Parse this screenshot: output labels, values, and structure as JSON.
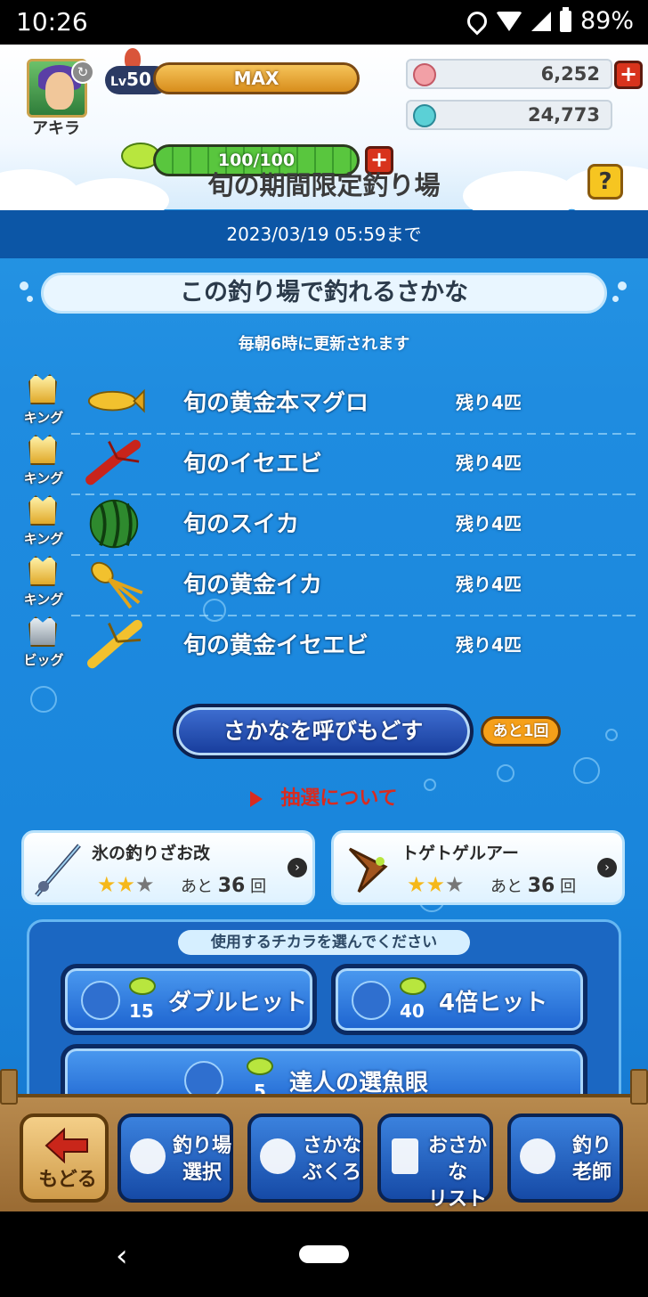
{
  "status_bar": {
    "time": "10:26",
    "battery": "89%"
  },
  "header": {
    "player_name": "アキラ",
    "level_prefix": "Lv",
    "level": "50",
    "xp_label": "MAX",
    "stamina": "100/100",
    "stamina_fraction": 1.0,
    "gems": "6,252",
    "medals": "24,773",
    "title": "旬の期間限定釣り場",
    "help_label": "?",
    "deadline": "2023/03/19  05:59まで"
  },
  "fish_section": {
    "heading": "この釣り場で釣れるさかな",
    "note": "毎朝6時に更新されます",
    "fish": [
      {
        "rank": "キング",
        "rank_type": "king",
        "name": "旬の黄金本マグロ",
        "remaining": "残り4匹",
        "icon": "golden-tuna-icon"
      },
      {
        "rank": "キング",
        "rank_type": "king",
        "name": "旬のイセエビ",
        "remaining": "残り4匹",
        "icon": "lobster-icon"
      },
      {
        "rank": "キング",
        "rank_type": "king",
        "name": "旬のスイカ",
        "remaining": "残り4匹",
        "icon": "watermelon-icon"
      },
      {
        "rank": "キング",
        "rank_type": "king",
        "name": "旬の黄金イカ",
        "remaining": "残り4匹",
        "icon": "golden-squid-icon"
      },
      {
        "rank": "ビッグ",
        "rank_type": "big",
        "name": "旬の黄金イセエビ",
        "remaining": "残り4匹",
        "icon": "golden-lobster-icon"
      }
    ]
  },
  "recall": {
    "label": "さかなを呼びもどす",
    "remaining": "あと1回"
  },
  "lottery_link": "抽選について",
  "gear": [
    {
      "name": "氷の釣りざお改",
      "stars_on": 2,
      "stars_total": 3,
      "uses_prefix": "あと",
      "uses": "36",
      "uses_suffix": "回",
      "icon": "ice-fishing-rod-icon"
    },
    {
      "name": "トゲトゲルアー",
      "stars_on": 2,
      "stars_total": 3,
      "uses_prefix": "あと",
      "uses": "36",
      "uses_suffix": "回",
      "icon": "spiky-lure-icon"
    }
  ],
  "powers": {
    "title": "使用するチカラを選んでください",
    "items": [
      {
        "label": "ダブルヒット",
        "cost": "15"
      },
      {
        "label": "4倍ヒット",
        "cost": "40"
      },
      {
        "label": "達人の選魚眼",
        "cost": "5"
      }
    ]
  },
  "nav": [
    {
      "label": "もどる",
      "icon": "back-arrow-icon"
    },
    {
      "label": "釣り場\n選択",
      "icon": "fishing-spot-icon"
    },
    {
      "label": "さかな\nぶくろ",
      "icon": "fish-bag-icon"
    },
    {
      "label": "おさかな\nリスト",
      "icon": "fish-list-icon"
    },
    {
      "label": "釣り\n老師",
      "icon": "fishing-master-icon"
    }
  ],
  "colors": {
    "accent_blue": "#1f8ce0",
    "link_red": "#d92b1f",
    "badge_orange": "#f6a019"
  }
}
